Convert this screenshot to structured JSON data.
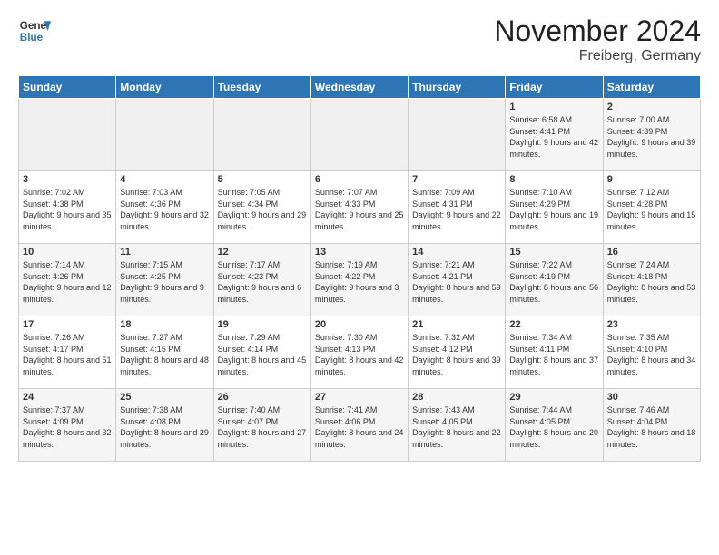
{
  "header": {
    "logo_general": "General",
    "logo_blue": "Blue",
    "month_title": "November 2024",
    "location": "Freiberg, Germany"
  },
  "days_of_week": [
    "Sunday",
    "Monday",
    "Tuesday",
    "Wednesday",
    "Thursday",
    "Friday",
    "Saturday"
  ],
  "weeks": [
    [
      {
        "day": "",
        "info": ""
      },
      {
        "day": "",
        "info": ""
      },
      {
        "day": "",
        "info": ""
      },
      {
        "day": "",
        "info": ""
      },
      {
        "day": "",
        "info": ""
      },
      {
        "day": "1",
        "info": "Sunrise: 6:58 AM\nSunset: 4:41 PM\nDaylight: 9 hours and 42 minutes."
      },
      {
        "day": "2",
        "info": "Sunrise: 7:00 AM\nSunset: 4:39 PM\nDaylight: 9 hours and 39 minutes."
      }
    ],
    [
      {
        "day": "3",
        "info": "Sunrise: 7:02 AM\nSunset: 4:38 PM\nDaylight: 9 hours and 35 minutes."
      },
      {
        "day": "4",
        "info": "Sunrise: 7:03 AM\nSunset: 4:36 PM\nDaylight: 9 hours and 32 minutes."
      },
      {
        "day": "5",
        "info": "Sunrise: 7:05 AM\nSunset: 4:34 PM\nDaylight: 9 hours and 29 minutes."
      },
      {
        "day": "6",
        "info": "Sunrise: 7:07 AM\nSunset: 4:33 PM\nDaylight: 9 hours and 25 minutes."
      },
      {
        "day": "7",
        "info": "Sunrise: 7:09 AM\nSunset: 4:31 PM\nDaylight: 9 hours and 22 minutes."
      },
      {
        "day": "8",
        "info": "Sunrise: 7:10 AM\nSunset: 4:29 PM\nDaylight: 9 hours and 19 minutes."
      },
      {
        "day": "9",
        "info": "Sunrise: 7:12 AM\nSunset: 4:28 PM\nDaylight: 9 hours and 15 minutes."
      }
    ],
    [
      {
        "day": "10",
        "info": "Sunrise: 7:14 AM\nSunset: 4:26 PM\nDaylight: 9 hours and 12 minutes."
      },
      {
        "day": "11",
        "info": "Sunrise: 7:15 AM\nSunset: 4:25 PM\nDaylight: 9 hours and 9 minutes."
      },
      {
        "day": "12",
        "info": "Sunrise: 7:17 AM\nSunset: 4:23 PM\nDaylight: 9 hours and 6 minutes."
      },
      {
        "day": "13",
        "info": "Sunrise: 7:19 AM\nSunset: 4:22 PM\nDaylight: 9 hours and 3 minutes."
      },
      {
        "day": "14",
        "info": "Sunrise: 7:21 AM\nSunset: 4:21 PM\nDaylight: 8 hours and 59 minutes."
      },
      {
        "day": "15",
        "info": "Sunrise: 7:22 AM\nSunset: 4:19 PM\nDaylight: 8 hours and 56 minutes."
      },
      {
        "day": "16",
        "info": "Sunrise: 7:24 AM\nSunset: 4:18 PM\nDaylight: 8 hours and 53 minutes."
      }
    ],
    [
      {
        "day": "17",
        "info": "Sunrise: 7:26 AM\nSunset: 4:17 PM\nDaylight: 8 hours and 51 minutes."
      },
      {
        "day": "18",
        "info": "Sunrise: 7:27 AM\nSunset: 4:15 PM\nDaylight: 8 hours and 48 minutes."
      },
      {
        "day": "19",
        "info": "Sunrise: 7:29 AM\nSunset: 4:14 PM\nDaylight: 8 hours and 45 minutes."
      },
      {
        "day": "20",
        "info": "Sunrise: 7:30 AM\nSunset: 4:13 PM\nDaylight: 8 hours and 42 minutes."
      },
      {
        "day": "21",
        "info": "Sunrise: 7:32 AM\nSunset: 4:12 PM\nDaylight: 8 hours and 39 minutes."
      },
      {
        "day": "22",
        "info": "Sunrise: 7:34 AM\nSunset: 4:11 PM\nDaylight: 8 hours and 37 minutes."
      },
      {
        "day": "23",
        "info": "Sunrise: 7:35 AM\nSunset: 4:10 PM\nDaylight: 8 hours and 34 minutes."
      }
    ],
    [
      {
        "day": "24",
        "info": "Sunrise: 7:37 AM\nSunset: 4:09 PM\nDaylight: 8 hours and 32 minutes."
      },
      {
        "day": "25",
        "info": "Sunrise: 7:38 AM\nSunset: 4:08 PM\nDaylight: 8 hours and 29 minutes."
      },
      {
        "day": "26",
        "info": "Sunrise: 7:40 AM\nSunset: 4:07 PM\nDaylight: 8 hours and 27 minutes."
      },
      {
        "day": "27",
        "info": "Sunrise: 7:41 AM\nSunset: 4:06 PM\nDaylight: 8 hours and 24 minutes."
      },
      {
        "day": "28",
        "info": "Sunrise: 7:43 AM\nSunset: 4:05 PM\nDaylight: 8 hours and 22 minutes."
      },
      {
        "day": "29",
        "info": "Sunrise: 7:44 AM\nSunset: 4:05 PM\nDaylight: 8 hours and 20 minutes."
      },
      {
        "day": "30",
        "info": "Sunrise: 7:46 AM\nSunset: 4:04 PM\nDaylight: 8 hours and 18 minutes."
      }
    ]
  ]
}
